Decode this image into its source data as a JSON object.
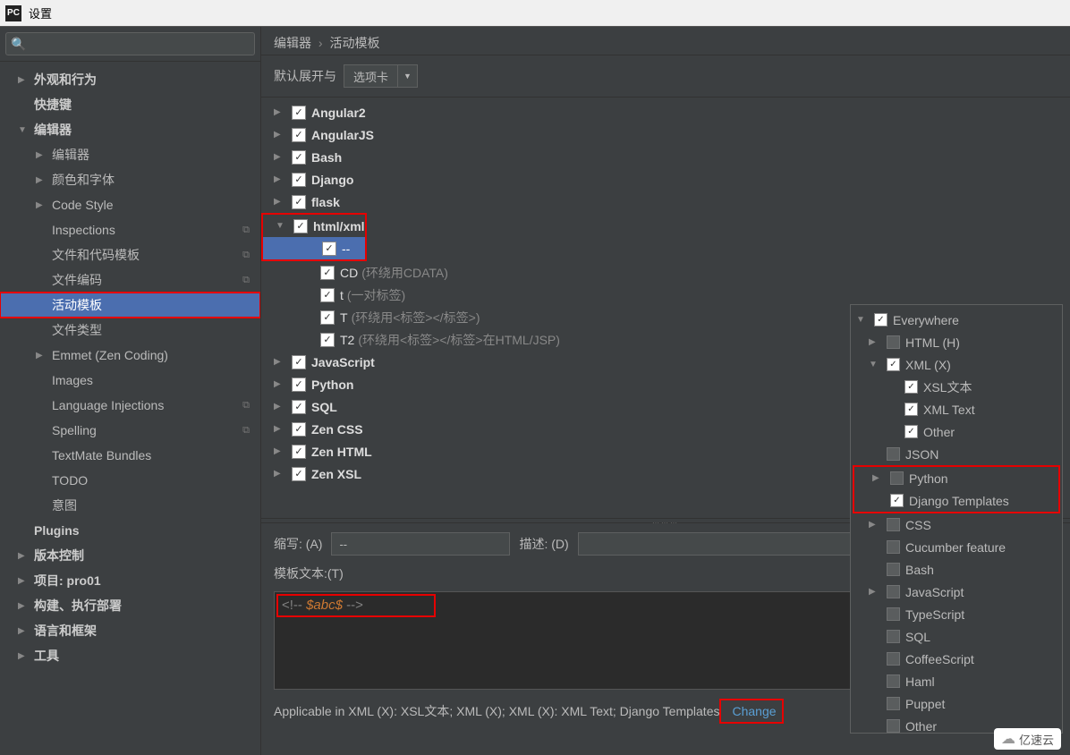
{
  "window": {
    "app_icon": "PC",
    "title": "设置"
  },
  "sidebar": {
    "items": [
      {
        "label": "外观和行为",
        "chevron": "▶",
        "lvl": 1,
        "bold": true
      },
      {
        "label": "快捷键",
        "chevron": "",
        "lvl": 1,
        "bold": true
      },
      {
        "label": "编辑器",
        "chevron": "▼",
        "lvl": 1,
        "bold": true
      },
      {
        "label": "编辑器",
        "chevron": "▶",
        "lvl": 2
      },
      {
        "label": "颜色和字体",
        "chevron": "▶",
        "lvl": 2
      },
      {
        "label": "Code Style",
        "chevron": "▶",
        "lvl": 2
      },
      {
        "label": "Inspections",
        "chevron": "",
        "lvl": 2,
        "badge": "⧉"
      },
      {
        "label": "文件和代码模板",
        "chevron": "",
        "lvl": 2,
        "badge": "⧉"
      },
      {
        "label": "文件编码",
        "chevron": "",
        "lvl": 2,
        "badge": "⧉"
      },
      {
        "label": "活动模板",
        "chevron": "",
        "lvl": 2,
        "selected": true,
        "redbox": true
      },
      {
        "label": "文件类型",
        "chevron": "",
        "lvl": 2
      },
      {
        "label": "Emmet (Zen Coding)",
        "chevron": "▶",
        "lvl": 2
      },
      {
        "label": "Images",
        "chevron": "",
        "lvl": 2
      },
      {
        "label": "Language Injections",
        "chevron": "",
        "lvl": 2,
        "badge": "⧉"
      },
      {
        "label": "Spelling",
        "chevron": "",
        "lvl": 2,
        "badge": "⧉"
      },
      {
        "label": "TextMate Bundles",
        "chevron": "",
        "lvl": 2
      },
      {
        "label": "TODO",
        "chevron": "",
        "lvl": 2
      },
      {
        "label": "意图",
        "chevron": "",
        "lvl": 2
      },
      {
        "label": "Plugins",
        "chevron": "",
        "lvl": 1,
        "bold": true
      },
      {
        "label": "版本控制",
        "chevron": "▶",
        "lvl": 1,
        "bold": true
      },
      {
        "label": "项目: pro01",
        "chevron": "▶",
        "lvl": 1,
        "bold": true
      },
      {
        "label": "构建、执行部署",
        "chevron": "▶",
        "lvl": 1,
        "bold": true
      },
      {
        "label": "语言和框架",
        "chevron": "▶",
        "lvl": 1,
        "bold": true
      },
      {
        "label": "工具",
        "chevron": "▶",
        "lvl": 1,
        "bold": true
      }
    ]
  },
  "breadcrumb": {
    "a": "编辑器",
    "b": "活动模板"
  },
  "options": {
    "label": "默认展开与",
    "select_value": "选项卡"
  },
  "templates": [
    {
      "chevron": "▶",
      "label": "Angular2",
      "checked": true
    },
    {
      "chevron": "▶",
      "label": "AngularJS",
      "checked": true
    },
    {
      "chevron": "▶",
      "label": "Bash",
      "checked": true
    },
    {
      "chevron": "▶",
      "label": "Django",
      "checked": true
    },
    {
      "chevron": "▶",
      "label": "flask",
      "checked": true
    },
    {
      "chevron": "▼",
      "label": "html/xml",
      "checked": true,
      "redbox": true
    },
    {
      "child": true,
      "label": "--",
      "sub": "",
      "checked": true,
      "selected": true,
      "redbox_inner": true
    },
    {
      "child": true,
      "label": "CD",
      "sub": "(环绕用CDATA)",
      "checked": true
    },
    {
      "child": true,
      "label": "t",
      "sub": "(一对标签)",
      "checked": true
    },
    {
      "child": true,
      "label": "T",
      "sub": "(环绕用<标签></标签>)",
      "checked": true
    },
    {
      "child": true,
      "label": "T2",
      "sub": "(环绕用<标签></标签>在HTML/JSP)",
      "checked": true
    },
    {
      "chevron": "▶",
      "label": "JavaScript",
      "checked": true
    },
    {
      "chevron": "▶",
      "label": "Python",
      "checked": true
    },
    {
      "chevron": "▶",
      "label": "SQL",
      "checked": true
    },
    {
      "chevron": "▶",
      "label": "Zen CSS",
      "checked": true
    },
    {
      "chevron": "▶",
      "label": "Zen HTML",
      "checked": true
    },
    {
      "chevron": "▶",
      "label": "Zen XSL",
      "checked": true
    }
  ],
  "editor": {
    "abbrev_label": "缩写: (A)",
    "abbrev_value": "--",
    "desc_label": "描述: (D)",
    "desc_value": "",
    "template_label": "模板文本:(T)",
    "code_prefix": "<!-- ",
    "code_var": "$abc$",
    "code_suffix": " -->",
    "applicable_text": "Applicable in XML (X): XSL文本; XML (X); XML (X): XML Text; Django Templates",
    "change_link": "Change"
  },
  "context_panel": [
    {
      "chevron": "▼",
      "label": "Everywhere",
      "checked": true,
      "lvl": 0
    },
    {
      "chevron": "▶",
      "label": "HTML (H)",
      "checked": false,
      "lvl": 1
    },
    {
      "chevron": "▼",
      "label": "XML (X)",
      "checked": true,
      "lvl": 1
    },
    {
      "chevron": "",
      "label": "XSL文本",
      "checked": true,
      "lvl": 2
    },
    {
      "chevron": "",
      "label": "XML Text",
      "checked": true,
      "lvl": 2
    },
    {
      "chevron": "",
      "label": "Other",
      "checked": true,
      "lvl": 2
    },
    {
      "chevron": "",
      "label": "JSON",
      "checked": false,
      "lvl": 1
    },
    {
      "chevron": "▶",
      "label": "Python",
      "checked": false,
      "lvl": 1,
      "redgroup": "start"
    },
    {
      "chevron": "",
      "label": "Django Templates",
      "checked": true,
      "lvl": 1,
      "redgroup": "end"
    },
    {
      "chevron": "▶",
      "label": "CSS",
      "checked": false,
      "lvl": 1
    },
    {
      "chevron": "",
      "label": "Cucumber feature",
      "checked": false,
      "lvl": 1
    },
    {
      "chevron": "",
      "label": "Bash",
      "checked": false,
      "lvl": 1
    },
    {
      "chevron": "▶",
      "label": "JavaScript",
      "checked": false,
      "lvl": 1
    },
    {
      "chevron": "",
      "label": "TypeScript",
      "checked": false,
      "lvl": 1
    },
    {
      "chevron": "",
      "label": "SQL",
      "checked": false,
      "lvl": 1
    },
    {
      "chevron": "",
      "label": "CoffeeScript",
      "checked": false,
      "lvl": 1
    },
    {
      "chevron": "",
      "label": "Haml",
      "checked": false,
      "lvl": 1
    },
    {
      "chevron": "",
      "label": "Puppet",
      "checked": false,
      "lvl": 1
    },
    {
      "chevron": "",
      "label": "Other",
      "checked": false,
      "lvl": 1
    }
  ],
  "watermark": "亿速云"
}
